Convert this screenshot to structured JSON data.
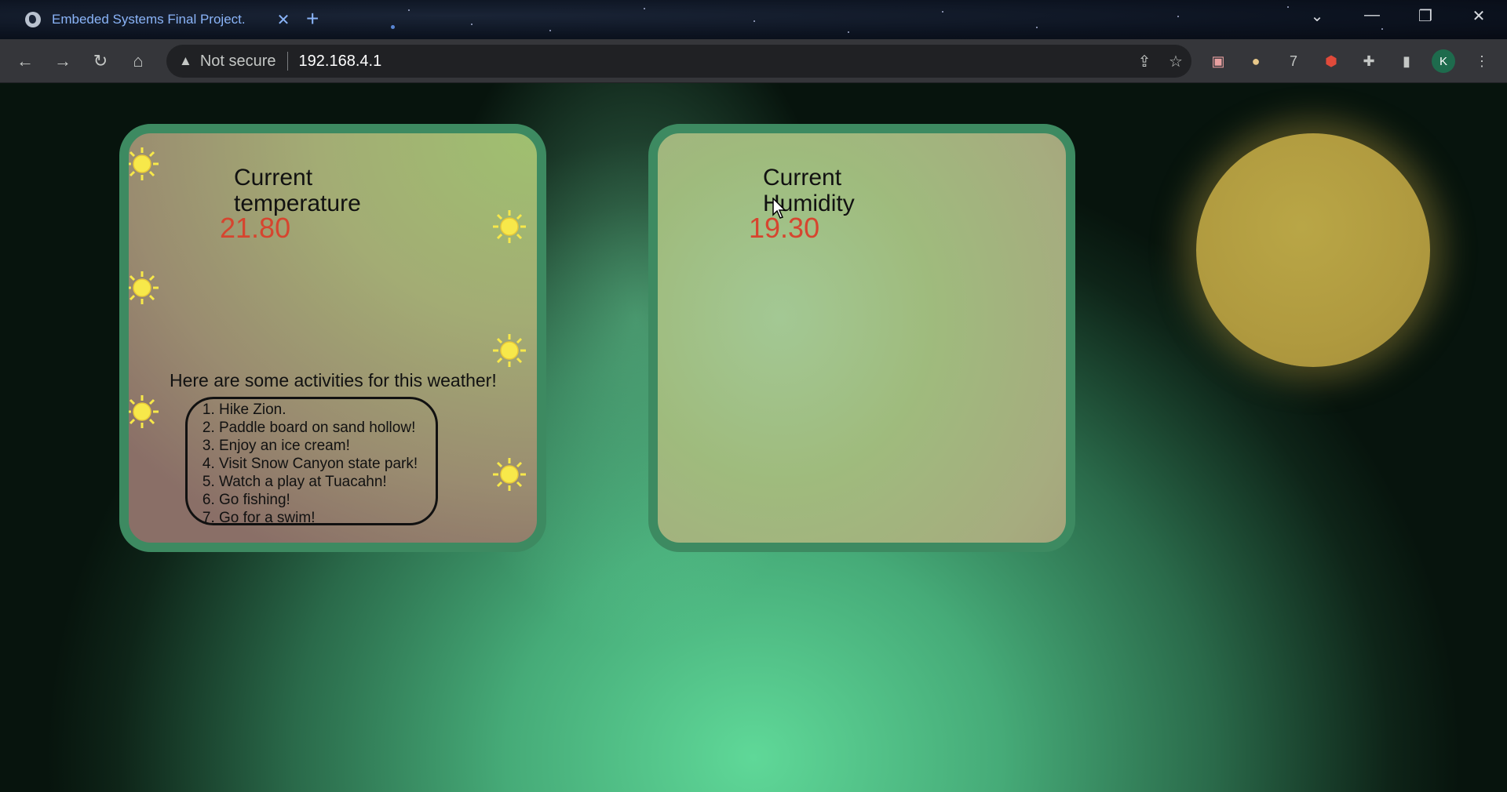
{
  "browser": {
    "tab_title": "Embeded Systems Final Project.",
    "tab_close": "✕",
    "new_tab": "+",
    "security_label": "Not secure",
    "url": "192.168.4.1",
    "profile_initial": "K"
  },
  "temperature_card": {
    "title_line1": "Current",
    "title_line2": "temperature",
    "value": "21.80",
    "activities_heading": "Here are some activities for this weather!",
    "activities": [
      "Hike Zion.",
      "Paddle board on sand hollow!",
      "Enjoy an ice cream!",
      "Visit Snow Canyon state park!",
      "Watch a play at Tuacahn!",
      "Go fishing!",
      "Go for a swim!"
    ]
  },
  "humidity_card": {
    "title_line1": "Current",
    "title_line2": "Humidity",
    "value": "19.30"
  },
  "colors": {
    "value_red": "#d6452f",
    "sun_yellow": "#f7e84a",
    "card_border": "#3d8a61",
    "orb": "#b09a3f"
  },
  "icons": [
    "sun-icon",
    "globe-favicon-icon",
    "back-icon",
    "forward-icon",
    "reload-icon",
    "home-icon",
    "warning-icon",
    "share-icon",
    "star-icon",
    "extensions-icon",
    "side-panel-icon",
    "menu-icon"
  ]
}
